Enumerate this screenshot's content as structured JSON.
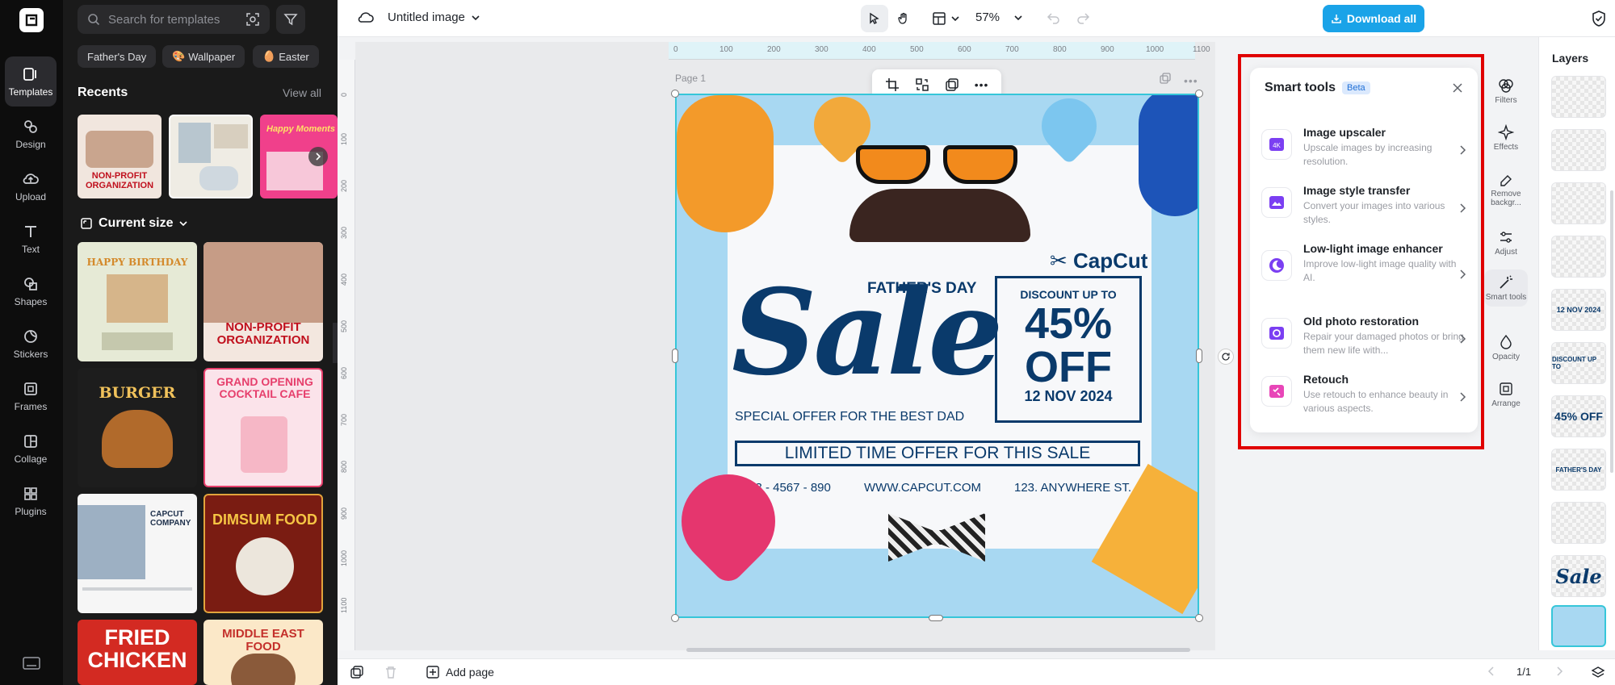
{
  "sidebar": {
    "items": [
      {
        "label": "Templates",
        "icon": "templates-icon"
      },
      {
        "label": "Design",
        "icon": "design-icon"
      },
      {
        "label": "Upload",
        "icon": "upload-icon"
      },
      {
        "label": "Text",
        "icon": "text-icon"
      },
      {
        "label": "Shapes",
        "icon": "shapes-icon"
      },
      {
        "label": "Stickers",
        "icon": "stickers-icon"
      },
      {
        "label": "Frames",
        "icon": "frames-icon"
      },
      {
        "label": "Collage",
        "icon": "collage-icon"
      },
      {
        "label": "Plugins",
        "icon": "plugins-icon"
      }
    ]
  },
  "templates": {
    "search_placeholder": "Search for templates",
    "chips": [
      "Father's Day",
      "Wallpaper",
      "Easter"
    ],
    "recents_title": "Recents",
    "view_all": "View all",
    "current_size": "Current size",
    "recent_thumbs": [
      {
        "label": "NON-PROFIT ORGANIZATION"
      },
      {
        "label": ""
      },
      {
        "label": "Happy Moments"
      }
    ],
    "grid": [
      {
        "label": "HAPPY BIRTHDAY"
      },
      {
        "label": "NON-PROFIT ORGANIZATION"
      },
      {
        "label": "BURGER"
      },
      {
        "label": "GRAND OPENING COCKTAIL CAFE"
      },
      {
        "label": "CAPCUT COMPANY"
      },
      {
        "label": "DIMSUM FOOD"
      },
      {
        "label": "FRIED CHICKEN"
      },
      {
        "label": "MIDDLE EAST FOOD"
      }
    ]
  },
  "topbar": {
    "title": "Untitled image",
    "zoom": "57%",
    "download_label": "Download all"
  },
  "ruler": {
    "h_ticks": [
      "0",
      "100",
      "200",
      "300",
      "400",
      "500",
      "600",
      "700",
      "800",
      "900",
      "1000",
      "1100"
    ],
    "v_ticks": [
      "0",
      "100",
      "200",
      "300",
      "400",
      "500",
      "600",
      "700",
      "800",
      "900",
      "1000",
      "1100"
    ]
  },
  "canvas": {
    "page_label": "Page 1",
    "design": {
      "brand": "CapCut",
      "fathers_day": "FATHER'S DAY",
      "sale": "Sale",
      "discount_up_to": "DISCOUNT UP TO",
      "percent": "45%",
      "off": "OFF",
      "date": "12 NOV 2024",
      "special_offer": "SPECIAL OFFER FOR THE BEST DAD",
      "limited_offer": "LIMITED TIME OFFER FOR THIS SALE",
      "phone": "+123 - 4567 - 890",
      "website": "WWW.CAPCUT.COM",
      "address": "123. ANYWHERE ST."
    }
  },
  "smart_tools": {
    "title": "Smart tools",
    "badge": "Beta",
    "items": [
      {
        "title": "Image upscaler",
        "desc": "Upscale images by increasing resolution."
      },
      {
        "title": "Image style transfer",
        "desc": "Convert your images into various styles."
      },
      {
        "title": "Low-light image enhancer",
        "desc": "Improve low-light image quality with AI."
      },
      {
        "title": "Old photo restoration",
        "desc": "Repair your damaged photos or bring them new life with..."
      },
      {
        "title": "Retouch",
        "desc": "Use retouch to enhance beauty in various aspects."
      }
    ]
  },
  "tool_strip": [
    {
      "label": "Filters"
    },
    {
      "label": "Effects"
    },
    {
      "label": "Remove backgr..."
    },
    {
      "label": "Adjust"
    },
    {
      "label": "Smart tools"
    },
    {
      "label": "Opacity"
    },
    {
      "label": "Arrange"
    }
  ],
  "layers": {
    "title": "Layers",
    "items": [
      "",
      "",
      "",
      "",
      "12 NOV 2024",
      "DISCOUNT UP TO",
      "45% OFF",
      "FATHER'S DAY",
      "",
      "Sale",
      ""
    ]
  },
  "bottombar": {
    "add_page": "Add page",
    "page_count": "1/1"
  },
  "colors": {
    "accent": "#1aa3e8",
    "navy": "#0a3a6b",
    "highlight": "#e00000",
    "artboard_bg": "#a8d8f2"
  }
}
